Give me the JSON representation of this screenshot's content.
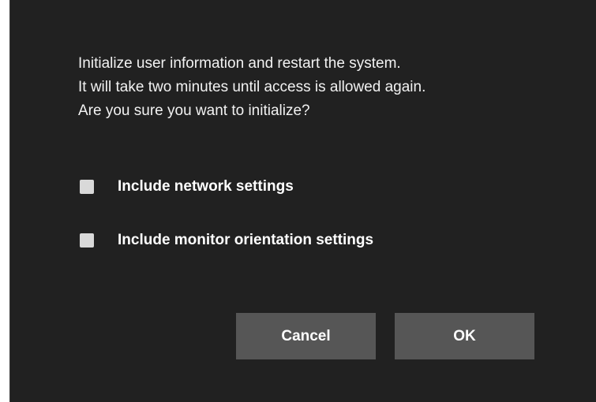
{
  "dialog": {
    "message_lines": [
      "Initialize user information and restart the system.",
      "It will take two minutes until access is allowed again.",
      "Are you sure you want to initialize?"
    ],
    "options": [
      {
        "label": "Include network settings",
        "checked": false
      },
      {
        "label": "Include monitor orientation settings",
        "checked": false
      }
    ],
    "buttons": {
      "cancel_label": "Cancel",
      "ok_label": "OK"
    }
  },
  "colors": {
    "dialog_background": "#212121",
    "button_background": "#565656",
    "checkbox_fill": "#d9d9d9",
    "text": "#ffffff"
  }
}
